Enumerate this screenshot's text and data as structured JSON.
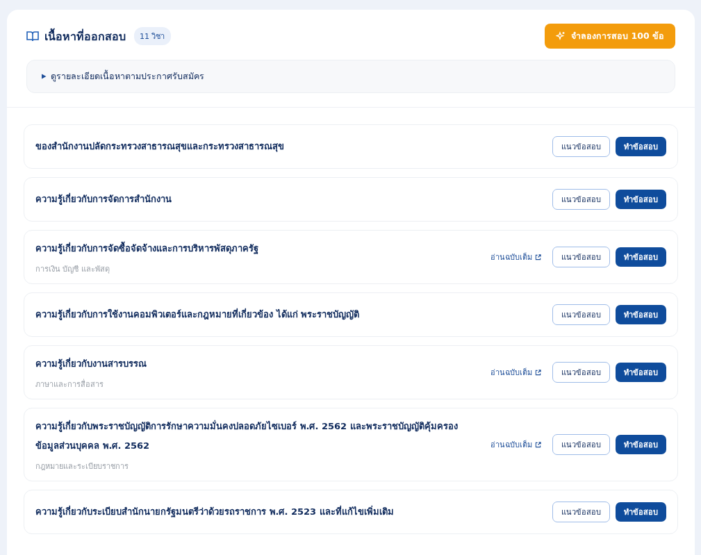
{
  "header": {
    "title": "เนื้อหาที่ออกสอบ",
    "count_badge": "11 วิชา",
    "simulate_button": "จำลองการสอบ 100 ข้อ"
  },
  "details": {
    "summary": "ดูรายละเอียดเนื้อหาตามประกาศรับสมัคร",
    "expanded": false
  },
  "subjects": [
    {
      "title": "ของสำนักงานปลัดกระทรวงสาธารณสุขและกระทรวงสาธารณสุข",
      "guide_button": "แนวข้อสอบ",
      "practice_button": "ทำข้อสอบ"
    },
    {
      "title": "ความรู้เกี่ยวกับการจัดการสำนักงาน",
      "guide_button": "แนวข้อสอบ",
      "practice_button": "ทำข้อสอบ"
    },
    {
      "title": "ความรู้เกี่ยวกับการจัดซื้อจัดจ้างและการบริหารพัสดุภาครัฐ",
      "category": "การเงิน บัญชี และพัสดุ",
      "read_link": "อ่านฉบับเต็ม",
      "guide_button": "แนวข้อสอบ",
      "practice_button": "ทำข้อสอบ"
    },
    {
      "title": "ความรู้เกี่ยวกับการใช้งานคอมพิวเตอร์และกฎหมายที่เกี่ยวข้อง ได้แก่ พระราชบัญญัติ",
      "guide_button": "แนวข้อสอบ",
      "practice_button": "ทำข้อสอบ"
    },
    {
      "title": "ความรู้เกี่ยวกับงานสารบรรณ",
      "category": "ภาษาและการสื่อสาร",
      "read_link": "อ่านฉบับเต็ม",
      "guide_button": "แนวข้อสอบ",
      "practice_button": "ทำข้อสอบ"
    },
    {
      "title": "ความรู้เกี่ยวกับพระราชบัญญัติการรักษาความมั่นคงปลอดภัยไซเบอร์ พ.ศ. 2562 และพระราชบัญญัติคุ้มครองข้อมูลส่วนบุคคล พ.ศ. 2562",
      "category": "กฎหมายและระเบียบราชการ",
      "read_link": "อ่านฉบับเต็ม",
      "guide_button": "แนวข้อสอบ",
      "practice_button": "ทำข้อสอบ"
    },
    {
      "title": "ความรู้เกี่ยวกับระเบียบสำนักนายกรัฐมนตรีว่าด้วยรถราชการ พ.ศ. 2523 และที่แก้ไขเพิ่มเติม",
      "guide_button": "แนวข้อสอบ",
      "practice_button": "ทำข้อสอบ"
    }
  ]
}
